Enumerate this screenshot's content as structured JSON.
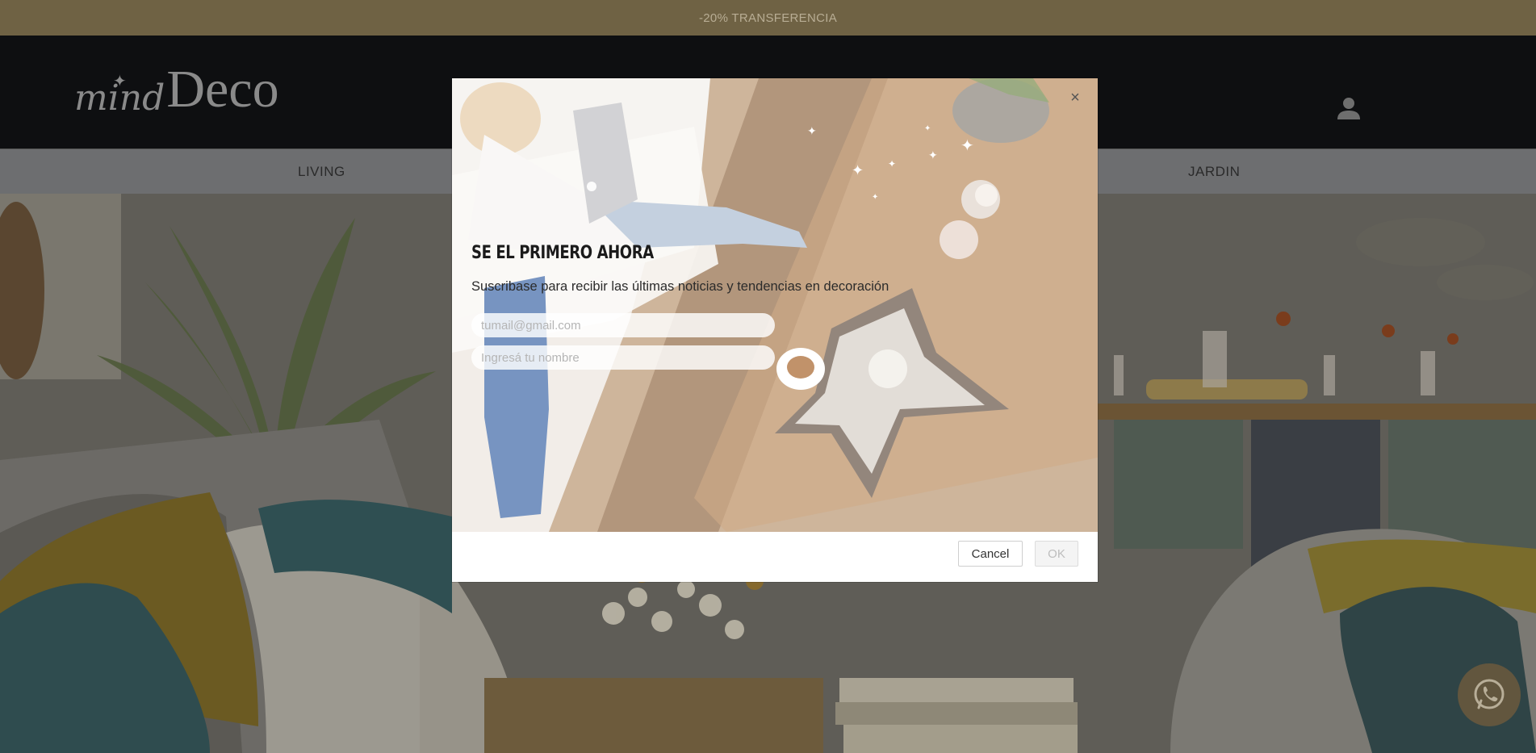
{
  "promo": {
    "text": "-20% TRANSFERENCIA"
  },
  "header": {
    "logo": {
      "part1": "mind",
      "part2": "Deco"
    },
    "account_icon": "user-icon"
  },
  "nav": {
    "items": [
      {
        "label": "LIVING"
      },
      {
        "label": "JARDIN"
      }
    ]
  },
  "modal": {
    "title": "SE EL PRIMERO AHORA",
    "subtitle": "Suscribase para recibir las últimas noticias y tendencias en decoración",
    "email_placeholder": "tumail@gmail.com",
    "name_placeholder": "Ingresá tu nombre",
    "cancel_label": "Cancel",
    "ok_label": "OK",
    "close_icon": "close-icon"
  },
  "whatsapp": {
    "icon": "whatsapp-icon"
  },
  "colors": {
    "promo_bg": "#6f6244",
    "header_bg": "#0e0f11",
    "nav_bg": "#6d6e70",
    "accent": "#62563e"
  }
}
